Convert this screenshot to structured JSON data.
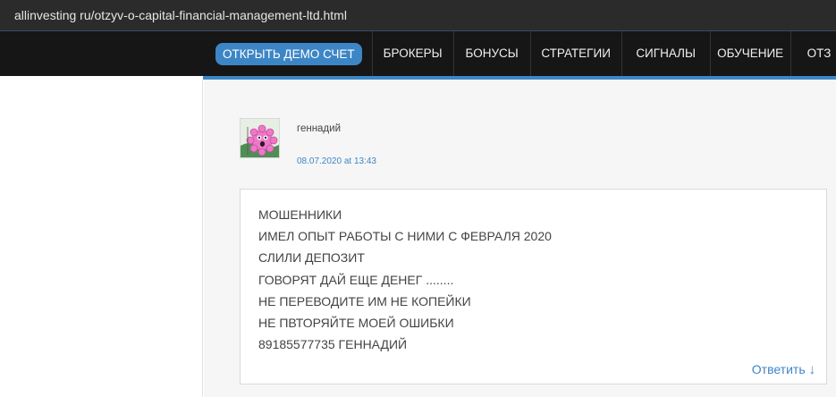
{
  "browser": {
    "url": "allinvesting ru/otzyv-o-capital-financial-management-ltd.html"
  },
  "nav": {
    "demo_button": "ОТКРЫТЬ ДЕМО СЧЕТ",
    "items": [
      "БРОКЕРЫ",
      "БОНУСЫ",
      "СТРАТЕГИИ",
      "СИГНАЛЫ",
      "ОБУЧЕНИЕ",
      "ОТЗ"
    ],
    "accent_color": "#3d86c6"
  },
  "comment": {
    "author": "геннадий",
    "date": "08.07.2020 at 13:43",
    "avatar_icon": "pink-gear-avatar-icon",
    "lines": [
      "МОШЕННИКИ",
      "ИМЕЛ ОПЫТ РАБОТЫ С НИМИ С ФЕВРАЛЯ 2020",
      "СЛИЛИ ДЕПОЗИТ",
      "ГОВОРЯТ ДАЙ ЕЩЕ ДЕНЕГ ........",
      "НЕ ПЕРЕВОДИТЕ ИМ НЕ КОПЕЙКИ",
      "НЕ ПВТОРЯЙТЕ МОЕЙ ОШИБКИ",
      "89185577735 ГЕННАДИЙ"
    ],
    "reply_label": "Ответить",
    "reply_icon": "↓"
  }
}
